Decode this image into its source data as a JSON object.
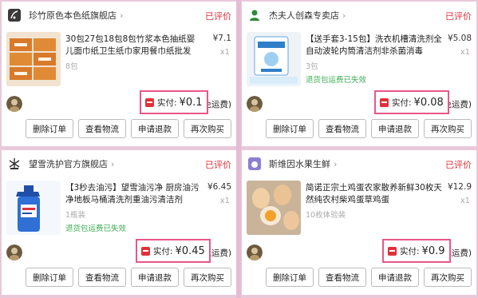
{
  "orders": [
    {
      "shop_name": "珍竹原色本色纸旗舰店",
      "shop_icon": "bamboo-logo-icon",
      "status": "已评价",
      "title": "30包27包18包8包竹浆本色抽纸婴儿面巾纸卫生纸巾家用餐巾纸批发",
      "price": "¥7.1",
      "qty": "x1",
      "spec": "8包",
      "tag": "",
      "paid_label": "实付:",
      "paid_amount": "¥0.1",
      "shipping": "免运费)",
      "buttons": [
        "删除订单",
        "查看物流",
        "申请退款",
        "再次购买"
      ]
    },
    {
      "shop_name": "杰夫人创森专卖店",
      "shop_icon": "person-logo-icon",
      "status": "已评价",
      "title": "【送手套3-15包】洗衣机槽清洗剂全自动波轮内筒清洁剂非杀菌消毒",
      "price": "¥5.08",
      "qty": "x1",
      "spec": "3包",
      "tag": "退货包运费已失效",
      "paid_label": "实付:",
      "paid_amount": "¥0.08",
      "shipping": "免运费)",
      "buttons": [
        "删除订单",
        "查看物流",
        "申请退款",
        "再次购买"
      ]
    },
    {
      "shop_name": "望雪洗护官方旗舰店",
      "shop_icon": "snow-logo-icon",
      "status": "已评价",
      "title": "【3秒去油污】望雪油污净 厨房油污净地板马桶清洗剂重油污清洁剂",
      "price": "¥6.45",
      "qty": "x1",
      "spec": "1瓶装",
      "tag": "退货包运费已失效",
      "paid_label": "实付:",
      "paid_amount": "¥0.45",
      "shipping": "(免运费)",
      "buttons": [
        "删除订单",
        "查看物流",
        "申请退款",
        "再次购买"
      ]
    },
    {
      "shop_name": "斯维因水果生鲜",
      "shop_icon": "fruit-logo-icon",
      "status": "已评价",
      "title": "简诺正宗土鸡蛋农家散养新鲜30枚天然纯农村柴鸡蛋草鸡蛋",
      "price": "¥12.9",
      "qty": "x1",
      "spec": "10枚体验装",
      "tag": "",
      "paid_label": "实付:",
      "paid_amount": "¥0.9",
      "shipping": "(免运费)",
      "buttons": [
        "删除订单",
        "查看物流",
        "申请退款",
        "再次购买"
      ]
    }
  ],
  "colors": {
    "accent_red": "#e0303a",
    "highlight_pink": "#e9568a",
    "tag_green": "#3fae55"
  }
}
